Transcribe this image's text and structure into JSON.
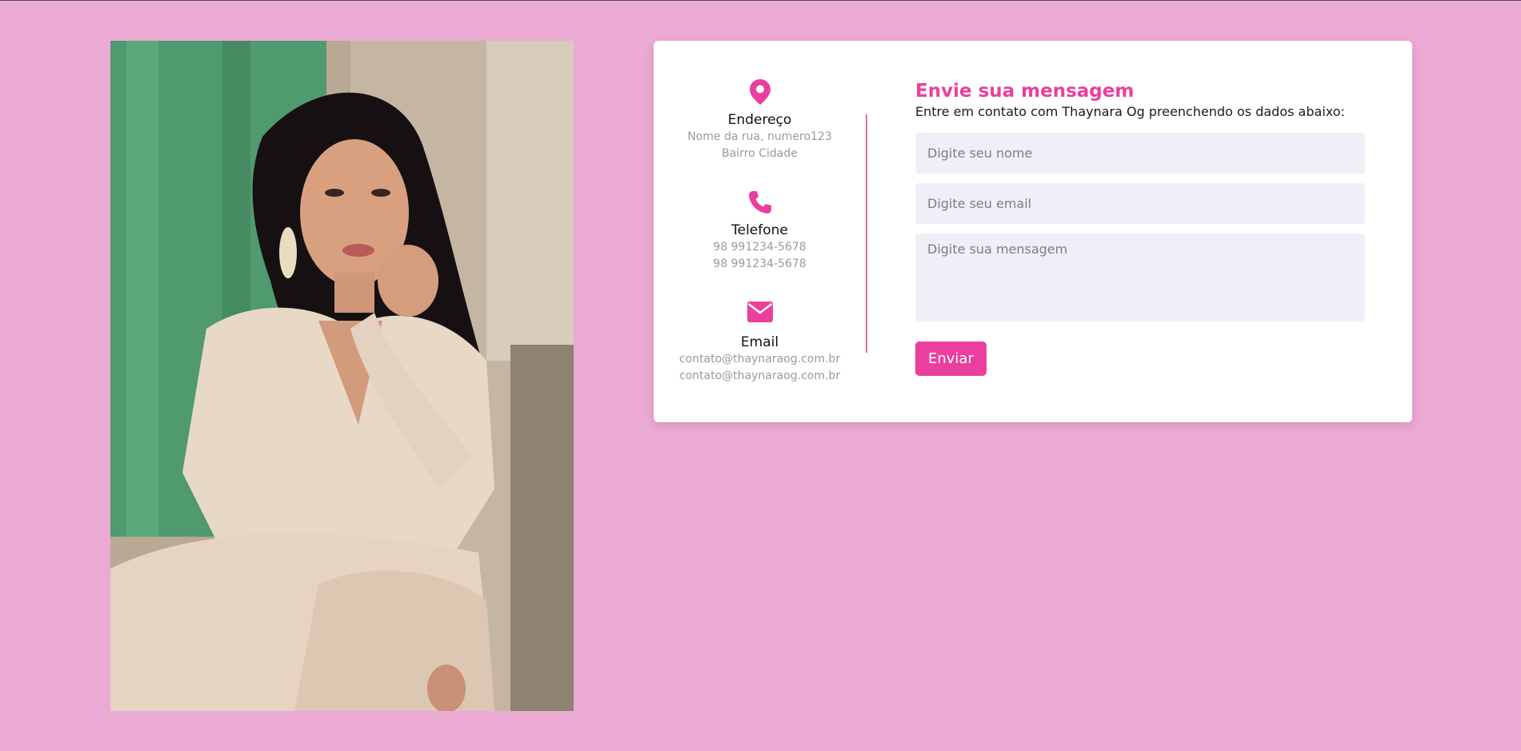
{
  "colors": {
    "background": "#ebaad3",
    "accent": "#ea3f9d",
    "card": "#ffffff"
  },
  "contact": {
    "address": {
      "icon": "map-pin-icon",
      "title": "Endereço",
      "lines": [
        "Nome da rua, numero123",
        "Bairro Cidade"
      ]
    },
    "phone": {
      "icon": "phone-icon",
      "title": "Telefone",
      "lines": [
        "98 991234-5678",
        "98 991234-5678"
      ]
    },
    "email": {
      "icon": "envelope-icon",
      "title": "Email",
      "lines": [
        "contato@thaynaraog.com.br",
        "contato@thaynaraog.com.br"
      ]
    }
  },
  "form": {
    "title": "Envie sua mensagem",
    "subtitle": "Entre em contato com Thaynara Og preenchendo os dados abaixo:",
    "name_placeholder": "Digite seu nome",
    "email_placeholder": "Digite seu email",
    "message_placeholder": "Digite sua mensagem",
    "submit_label": "Enviar"
  }
}
